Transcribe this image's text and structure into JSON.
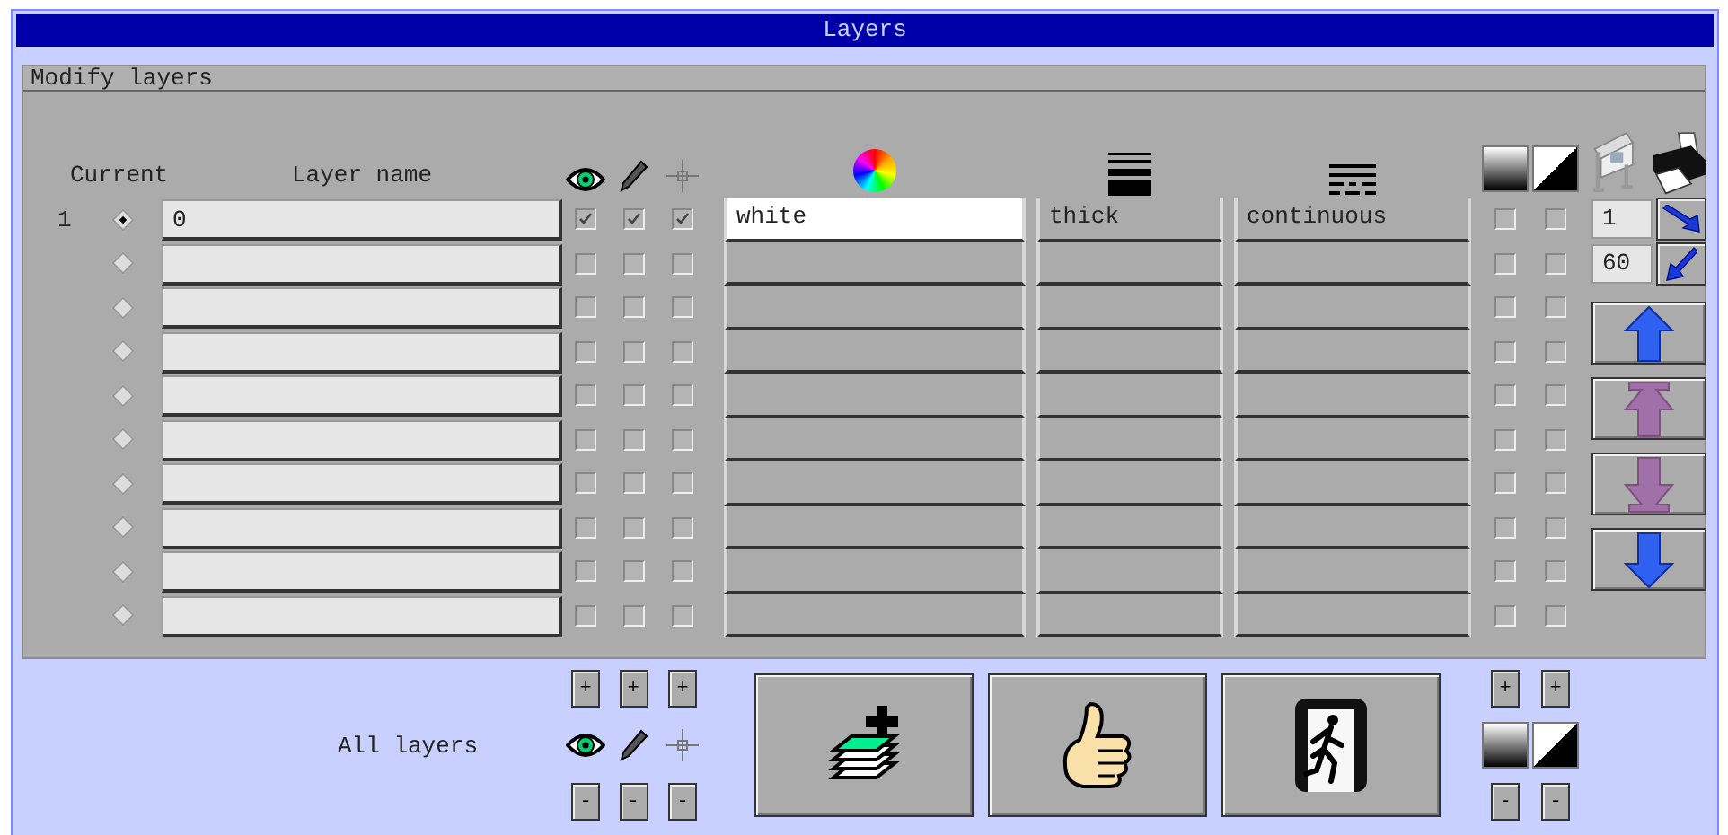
{
  "window": {
    "title": "Layers"
  },
  "panel": {
    "title": "Modify layers"
  },
  "columns": {
    "current": "Current",
    "layer_name": "Layer name"
  },
  "layers": [
    {
      "number": "1",
      "current": true,
      "name": "0",
      "visible": true,
      "editable": true,
      "snap": true,
      "color_name": "white",
      "color": "#ffffff",
      "lineweight": "thick",
      "linetype": "continuous",
      "fill": false,
      "invert": false
    },
    {
      "current": false,
      "visible": false,
      "editable": false,
      "snap": false,
      "fill": false,
      "invert": false
    },
    {
      "current": false,
      "visible": false,
      "editable": false,
      "snap": false,
      "fill": false,
      "invert": false
    },
    {
      "current": false,
      "visible": false,
      "editable": false,
      "snap": false,
      "fill": false,
      "invert": false
    },
    {
      "current": false,
      "visible": false,
      "editable": false,
      "snap": false,
      "fill": false,
      "invert": false
    },
    {
      "current": false,
      "visible": false,
      "editable": false,
      "snap": false,
      "fill": false,
      "invert": false
    },
    {
      "current": false,
      "visible": false,
      "editable": false,
      "snap": false,
      "fill": false,
      "invert": false
    },
    {
      "current": false,
      "visible": false,
      "editable": false,
      "snap": false,
      "fill": false,
      "invert": false
    },
    {
      "current": false,
      "visible": false,
      "editable": false,
      "snap": false,
      "fill": false,
      "invert": false
    },
    {
      "current": false,
      "visible": false,
      "editable": false,
      "snap": false,
      "fill": false,
      "invert": false
    }
  ],
  "pen_fields": [
    {
      "value": "1",
      "kind": "pen-down"
    },
    {
      "value": "60",
      "kind": "pen-up"
    }
  ],
  "move_buttons": [
    {
      "kind": "up",
      "disabled": false
    },
    {
      "kind": "top",
      "disabled": true
    },
    {
      "kind": "bottom",
      "disabled": true
    },
    {
      "kind": "down",
      "disabled": false
    }
  ],
  "all_layers": {
    "label": "All layers",
    "plus": [
      "+",
      "+",
      "+"
    ],
    "minus": [
      "-",
      "-",
      "-"
    ]
  },
  "actions": [
    {
      "kind": "new-layer"
    },
    {
      "kind": "ok"
    },
    {
      "kind": "exit"
    }
  ],
  "fill_controls": {
    "plus": [
      "+",
      "+"
    ],
    "minus": [
      "-",
      "-"
    ]
  }
}
